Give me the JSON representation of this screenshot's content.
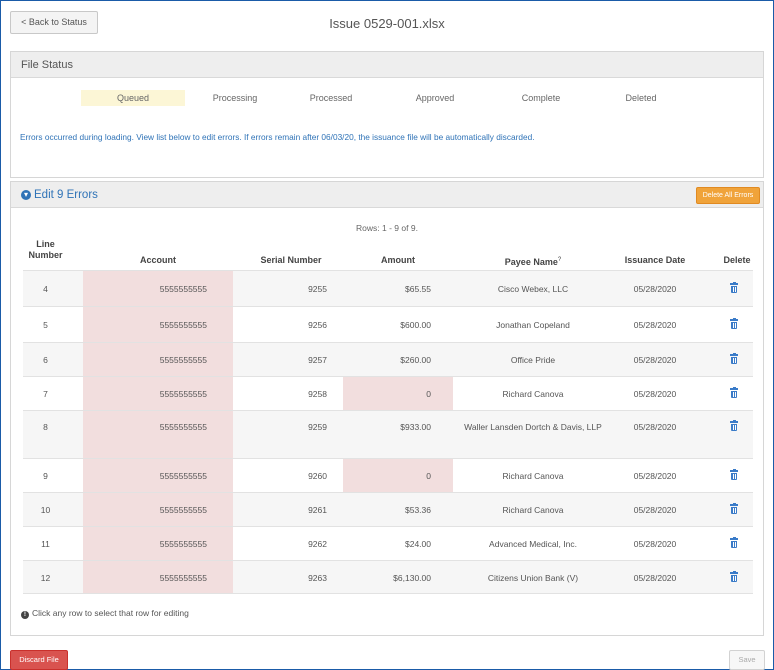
{
  "header": {
    "back_label": "< Back to Status",
    "title": "Issue 0529-001.xlsx"
  },
  "file_status": {
    "heading": "File Status",
    "active_step": "Queued",
    "steps": [
      "Queued",
      "Processing",
      "Processed",
      "Approved",
      "Complete",
      "Deleted"
    ],
    "message": "Errors occurred during loading. View list below to edit errors. If errors remain after 06/03/20, the issuance file will be automatically discarded."
  },
  "errors": {
    "title": "Edit 9 Errors",
    "delete_all_label": "Delete All Errors",
    "rows_info": "Rows: 1 - 9 of 9.",
    "columns": {
      "line": "Line\nNumber",
      "account": "Account",
      "serial": "Serial Number",
      "amount": "Amount",
      "payee": "Payee Name",
      "payee_mark": "?",
      "date": "Issuance Date",
      "delete": "Delete"
    },
    "rows": [
      {
        "line": "4",
        "account": "5555555555",
        "serial": "9255",
        "amount": "$65.55",
        "payee": "Cisco Webex, LLC",
        "date": "05/28/2020",
        "account_error": true,
        "amount_error": false
      },
      {
        "line": "5",
        "account": "5555555555",
        "serial": "9256",
        "amount": "$600.00",
        "payee": "Jonathan Copeland",
        "date": "05/28/2020",
        "account_error": true,
        "amount_error": false
      },
      {
        "line": "6",
        "account": "5555555555",
        "serial": "9257",
        "amount": "$260.00",
        "payee": "Office Pride",
        "date": "05/28/2020",
        "account_error": true,
        "amount_error": false
      },
      {
        "line": "7",
        "account": "5555555555",
        "serial": "9258",
        "amount": "0",
        "payee": "Richard Canova",
        "date": "05/28/2020",
        "account_error": true,
        "amount_error": true
      },
      {
        "line": "8",
        "account": "5555555555",
        "serial": "9259",
        "amount": "$933.00",
        "payee": "Waller Lansden Dortch & Davis, LLP",
        "date": "05/28/2020",
        "account_error": true,
        "amount_error": false
      },
      {
        "line": "9",
        "account": "5555555555",
        "serial": "9260",
        "amount": "0",
        "payee": "Richard Canova",
        "date": "05/28/2020",
        "account_error": true,
        "amount_error": true
      },
      {
        "line": "10",
        "account": "5555555555",
        "serial": "9261",
        "amount": "$53.36",
        "payee": "Richard Canova",
        "date": "05/28/2020",
        "account_error": true,
        "amount_error": false
      },
      {
        "line": "11",
        "account": "5555555555",
        "serial": "9262",
        "amount": "$24.00",
        "payee": "Advanced Medical, Inc.",
        "date": "05/28/2020",
        "account_error": true,
        "amount_error": false
      },
      {
        "line": "12",
        "account": "5555555555",
        "serial": "9263",
        "amount": "$6,130.00",
        "payee": "Citizens Union Bank (V)",
        "date": "05/28/2020",
        "account_error": true,
        "amount_error": false
      }
    ],
    "hint": "Click any row to select that row for editing",
    "hint_icon": "info-icon"
  },
  "footer": {
    "discard_label": "Discard File",
    "save_label": "Save"
  },
  "colors": {
    "accent_blue": "#2f73b7",
    "error_fill": "#f2dede",
    "active_step_fill": "#fcf6d6",
    "delete_all_button": "#f0a33a",
    "discard_button": "#d9534f"
  }
}
